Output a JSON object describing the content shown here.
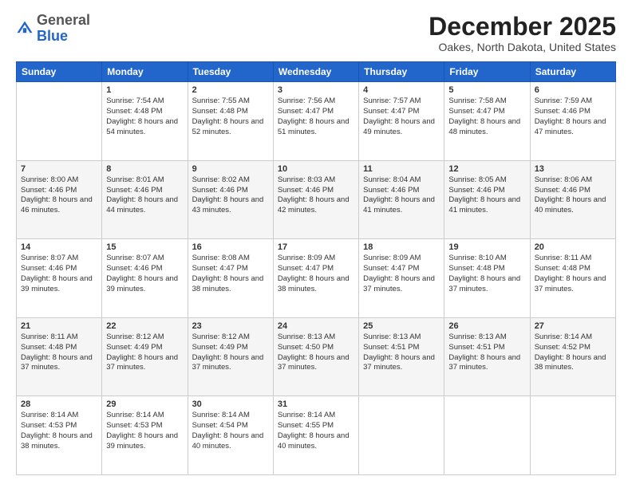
{
  "header": {
    "logo_general": "General",
    "logo_blue": "Blue",
    "month_title": "December 2025",
    "location": "Oakes, North Dakota, United States"
  },
  "days_of_week": [
    "Sunday",
    "Monday",
    "Tuesday",
    "Wednesday",
    "Thursday",
    "Friday",
    "Saturday"
  ],
  "weeks": [
    [
      {
        "day": "",
        "sunrise": "",
        "sunset": "",
        "daylight": ""
      },
      {
        "day": "1",
        "sunrise": "7:54 AM",
        "sunset": "4:48 PM",
        "daylight": "8 hours and 54 minutes."
      },
      {
        "day": "2",
        "sunrise": "7:55 AM",
        "sunset": "4:48 PM",
        "daylight": "8 hours and 52 minutes."
      },
      {
        "day": "3",
        "sunrise": "7:56 AM",
        "sunset": "4:47 PM",
        "daylight": "8 hours and 51 minutes."
      },
      {
        "day": "4",
        "sunrise": "7:57 AM",
        "sunset": "4:47 PM",
        "daylight": "8 hours and 49 minutes."
      },
      {
        "day": "5",
        "sunrise": "7:58 AM",
        "sunset": "4:47 PM",
        "daylight": "8 hours and 48 minutes."
      },
      {
        "day": "6",
        "sunrise": "7:59 AM",
        "sunset": "4:46 PM",
        "daylight": "8 hours and 47 minutes."
      }
    ],
    [
      {
        "day": "7",
        "sunrise": "8:00 AM",
        "sunset": "4:46 PM",
        "daylight": "8 hours and 46 minutes."
      },
      {
        "day": "8",
        "sunrise": "8:01 AM",
        "sunset": "4:46 PM",
        "daylight": "8 hours and 44 minutes."
      },
      {
        "day": "9",
        "sunrise": "8:02 AM",
        "sunset": "4:46 PM",
        "daylight": "8 hours and 43 minutes."
      },
      {
        "day": "10",
        "sunrise": "8:03 AM",
        "sunset": "4:46 PM",
        "daylight": "8 hours and 42 minutes."
      },
      {
        "day": "11",
        "sunrise": "8:04 AM",
        "sunset": "4:46 PM",
        "daylight": "8 hours and 41 minutes."
      },
      {
        "day": "12",
        "sunrise": "8:05 AM",
        "sunset": "4:46 PM",
        "daylight": "8 hours and 41 minutes."
      },
      {
        "day": "13",
        "sunrise": "8:06 AM",
        "sunset": "4:46 PM",
        "daylight": "8 hours and 40 minutes."
      }
    ],
    [
      {
        "day": "14",
        "sunrise": "8:07 AM",
        "sunset": "4:46 PM",
        "daylight": "8 hours and 39 minutes."
      },
      {
        "day": "15",
        "sunrise": "8:07 AM",
        "sunset": "4:46 PM",
        "daylight": "8 hours and 39 minutes."
      },
      {
        "day": "16",
        "sunrise": "8:08 AM",
        "sunset": "4:47 PM",
        "daylight": "8 hours and 38 minutes."
      },
      {
        "day": "17",
        "sunrise": "8:09 AM",
        "sunset": "4:47 PM",
        "daylight": "8 hours and 38 minutes."
      },
      {
        "day": "18",
        "sunrise": "8:09 AM",
        "sunset": "4:47 PM",
        "daylight": "8 hours and 37 minutes."
      },
      {
        "day": "19",
        "sunrise": "8:10 AM",
        "sunset": "4:48 PM",
        "daylight": "8 hours and 37 minutes."
      },
      {
        "day": "20",
        "sunrise": "8:11 AM",
        "sunset": "4:48 PM",
        "daylight": "8 hours and 37 minutes."
      }
    ],
    [
      {
        "day": "21",
        "sunrise": "8:11 AM",
        "sunset": "4:48 PM",
        "daylight": "8 hours and 37 minutes."
      },
      {
        "day": "22",
        "sunrise": "8:12 AM",
        "sunset": "4:49 PM",
        "daylight": "8 hours and 37 minutes."
      },
      {
        "day": "23",
        "sunrise": "8:12 AM",
        "sunset": "4:49 PM",
        "daylight": "8 hours and 37 minutes."
      },
      {
        "day": "24",
        "sunrise": "8:13 AM",
        "sunset": "4:50 PM",
        "daylight": "8 hours and 37 minutes."
      },
      {
        "day": "25",
        "sunrise": "8:13 AM",
        "sunset": "4:51 PM",
        "daylight": "8 hours and 37 minutes."
      },
      {
        "day": "26",
        "sunrise": "8:13 AM",
        "sunset": "4:51 PM",
        "daylight": "8 hours and 37 minutes."
      },
      {
        "day": "27",
        "sunrise": "8:14 AM",
        "sunset": "4:52 PM",
        "daylight": "8 hours and 38 minutes."
      }
    ],
    [
      {
        "day": "28",
        "sunrise": "8:14 AM",
        "sunset": "4:53 PM",
        "daylight": "8 hours and 38 minutes."
      },
      {
        "day": "29",
        "sunrise": "8:14 AM",
        "sunset": "4:53 PM",
        "daylight": "8 hours and 39 minutes."
      },
      {
        "day": "30",
        "sunrise": "8:14 AM",
        "sunset": "4:54 PM",
        "daylight": "8 hours and 40 minutes."
      },
      {
        "day": "31",
        "sunrise": "8:14 AM",
        "sunset": "4:55 PM",
        "daylight": "8 hours and 40 minutes."
      },
      {
        "day": "",
        "sunrise": "",
        "sunset": "",
        "daylight": ""
      },
      {
        "day": "",
        "sunrise": "",
        "sunset": "",
        "daylight": ""
      },
      {
        "day": "",
        "sunrise": "",
        "sunset": "",
        "daylight": ""
      }
    ]
  ]
}
